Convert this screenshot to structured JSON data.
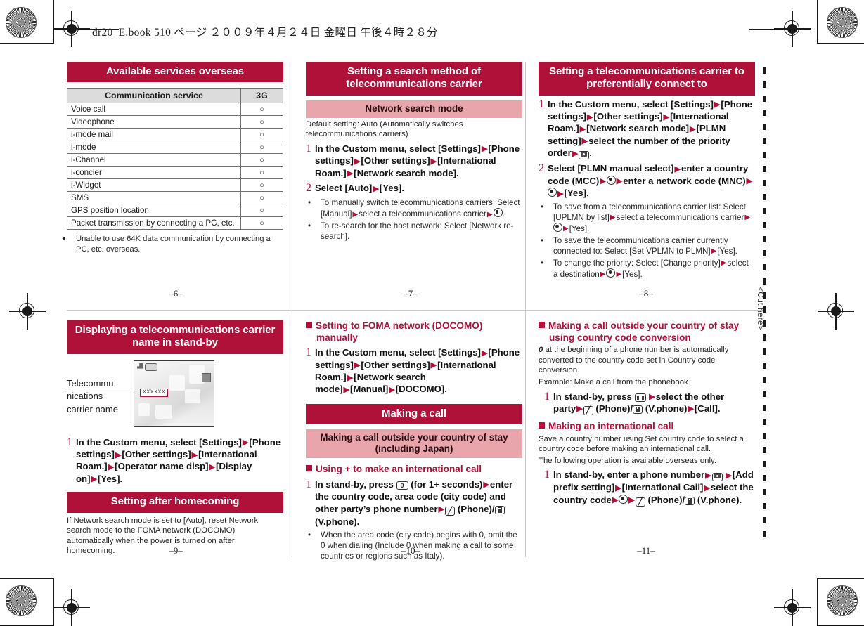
{
  "slug": "dr20_E.book   510 ページ   ２００９年４月２４日   金曜日   午後４時２８分",
  "cut_label": "<Cut here>",
  "colors": {
    "heading_red": "#B01139",
    "subheading_pink": "#E8A6AC",
    "table_header_gray": "#DCDCDC"
  },
  "folios": {
    "p6": "–6–",
    "p7": "–7–",
    "p8": "–8–",
    "p9": "–9–",
    "p10": "–10–",
    "p11": "–11–"
  },
  "panel1": {
    "title": "Available services overseas",
    "table": {
      "headers": [
        "Communication service",
        "3G"
      ],
      "rows": [
        [
          "Voice call",
          "○"
        ],
        [
          "Videophone",
          "○"
        ],
        [
          "i-mode mail",
          "○"
        ],
        [
          "i-mode",
          "○"
        ],
        [
          "i-Channel",
          "○"
        ],
        [
          "i-concier",
          "○"
        ],
        [
          "i-Widget",
          "○"
        ],
        [
          "SMS",
          "○"
        ],
        [
          "GPS position location",
          "○"
        ],
        [
          "Packet transmission by connecting a PC, etc.",
          "○"
        ]
      ]
    },
    "note": "Unable to use 64K data communication by connecting a PC, etc. overseas."
  },
  "panel2": {
    "title": "Setting a search method of telecommunications carrier",
    "subheading": "Network search mode",
    "default_note": "Default setting: Auto (Automatically switches telecommunications carriers)",
    "step1_num": "1",
    "step1_a": "In the Custom menu, select [Settings]",
    "step1_b": "[Phone settings]",
    "step1_c": "[Other settings]",
    "step1_d": "[International Roam.]",
    "step1_e": "[Network search mode].",
    "step2_num": "2",
    "step2_a": "Select [Auto]",
    "step2_b": "[Yes].",
    "bullet1_a": "To manually switch telecommunications carriers: Select [Manual]",
    "bullet1_b": "select a telecommunications carrier",
    "bullet1_c": ".",
    "bullet2": "To re-search for the host network: Select [Network re-search]."
  },
  "panel3": {
    "title": "Setting a telecommunications carrier to preferentially connect to",
    "step1_num": "1",
    "step1_a": "In the Custom menu, select [Settings]",
    "step1_b": "[Phone settings]",
    "step1_c": "[Other settings]",
    "step1_d": "[International Roam.]",
    "step1_e": "[Network search mode]",
    "step1_f": "[PLMN setting]",
    "step1_g": "select the number of the priority order",
    "step1_h": ".",
    "step2_num": "2",
    "step2_a": "Select [PLMN manual select]",
    "step2_b": "enter a country code (MCC)",
    "step2_c": "enter a network code (MNC)",
    "step2_d": "[Yes].",
    "bullet1_a": "To save from a telecommunications carrier list: Select [UPLMN by list]",
    "bullet1_b": "select a telecommunications carrier",
    "bullet1_c": "[Yes].",
    "bullet2_a": "To save the telecommunications carrier currently connected to: Select [Set VPLMN to PLMN]",
    "bullet2_b": "[Yes].",
    "bullet3_a": "To change the priority: Select [Change priority]",
    "bullet3_b": "select a destination",
    "bullet3_c": "[Yes]."
  },
  "panel4": {
    "title": "Displaying a telecommunications carrier name in stand-by",
    "callout": "Telecommu-\nnications\ncarrier name",
    "screen_carrier_label": "XXXXXX",
    "step1_num": "1",
    "step1_a": "In the Custom menu, select [Settings]",
    "step1_b": "[Phone settings]",
    "step1_c": "[Other settings]",
    "step1_d": "[International Roam.]",
    "step1_e": "[Operator name disp]",
    "step1_f": "[Display on]",
    "step1_g": "[Yes].",
    "subtitle2": "Setting after homecoming",
    "body2": "If Network search mode is set to [Auto], reset Network search mode to the FOMA network (DOCOMO) automatically when the power is turned on after homecoming."
  },
  "panel5": {
    "heading1": "Setting to FOMA network (DOCOMO) manually",
    "step1_num": "1",
    "step1_a": "In the Custom menu, select [Settings]",
    "step1_b": "[Phone settings]",
    "step1_c": "[Other settings]",
    "step1_d": "[International Roam.]",
    "step1_e": "[Network search mode]",
    "step1_f": "[Manual]",
    "step1_g": "[DOCOMO].",
    "title2": "Making a call",
    "subheading2": "Making a call outside your country of stay (including Japan)",
    "heading3": "Using + to make an international call",
    "step2_num": "1",
    "step2_a": "In stand-by, press",
    "step2_key": "0",
    "step2_b": "(for 1+ seconds)",
    "step2_c": "enter the country code, area code (city code) and other party’s phone number",
    "step2_d": "(Phone)/",
    "step2_e": "(V.phone).",
    "bullet1": "When the area code (city code) begins with 0, omit the 0 when dialing (Include 0 when making a call to some countries or regions such as Italy)."
  },
  "panel6": {
    "heading1": "Making a call outside your country of stay using country code conversion",
    "body1_lead": "0",
    "body1": " at the beginning of a phone number is automatically converted to the country code set in Country code conversion.",
    "body1b": "Example: Make a call from the phonebook",
    "step1_num": "1",
    "step1_a": "In stand-by, press",
    "step1_b": "select the other party",
    "step1_c": "(Phone)/",
    "step1_d": "(V.phone)",
    "step1_e": "[Call].",
    "heading2": "Making an international call",
    "body2": "Save a country number using Set country code to select a country code before making an international call.",
    "body2b": "The following operation is available overseas only.",
    "step2_num": "1",
    "step2_a": "In stand-by, enter a phone number",
    "step2_b": "[Add prefix setting]",
    "step2_c": "[International Call]",
    "step2_d": "select the country code",
    "step2_e": "(Phone)/",
    "step2_f": "(V.phone)."
  }
}
